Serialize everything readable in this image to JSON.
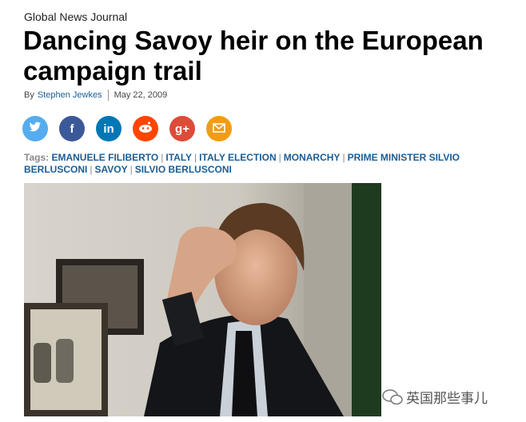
{
  "publication": "Global News Journal",
  "headline": "Dancing Savoy heir on the European campaign trail",
  "byline": {
    "prefix": "By",
    "author": "Stephen Jewkes",
    "date": "May 22, 2009"
  },
  "share_buttons": [
    {
      "name": "twitter-share-button",
      "icon": "twitter-bird-icon",
      "glyph": "t",
      "color": "#55acee"
    },
    {
      "name": "facebook-share-button",
      "icon": "facebook-f-icon",
      "glyph": "f",
      "color": "#3b5998"
    },
    {
      "name": "linkedin-share-button",
      "icon": "linkedin-in-icon",
      "glyph": "in",
      "color": "#0077b5"
    },
    {
      "name": "reddit-share-button",
      "icon": "reddit-alien-icon",
      "glyph": "",
      "color": "#ff4500"
    },
    {
      "name": "googleplus-share-button",
      "icon": "google-plus-icon",
      "glyph": "g+",
      "color": "#dd4b39"
    },
    {
      "name": "email-share-button",
      "icon": "envelope-icon",
      "glyph": "",
      "color": "#f39c12"
    }
  ],
  "tags": {
    "label": "Tags:",
    "items": [
      "EMANUELE FILIBERTO",
      "ITALY",
      "ITALY ELECTION",
      "MONARCHY",
      "PRIME MINISTER SILVIO BERLUSCONI",
      "SAVOY",
      "SILVIO BERLUSCONI"
    ]
  },
  "watermark": "英国那些事儿"
}
